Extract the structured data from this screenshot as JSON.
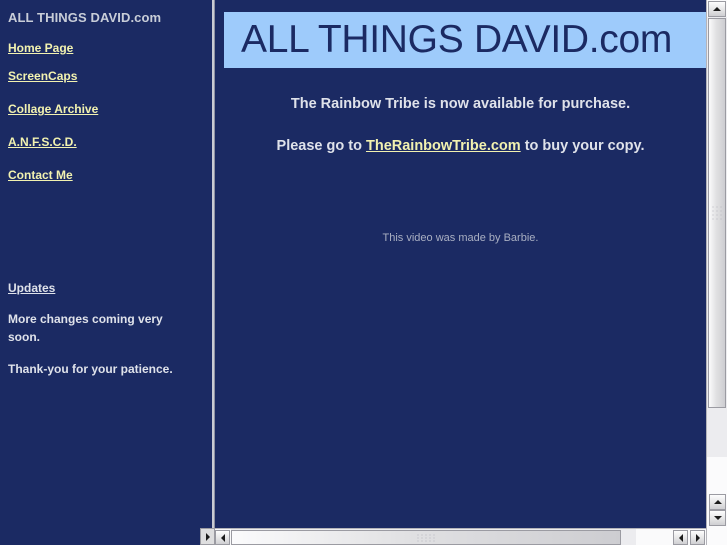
{
  "sidebar": {
    "site_title": "ALL THINGS DAVID.com",
    "nav_links": [
      {
        "label": "Home Page",
        "name": "nav-link-home-page"
      },
      {
        "label": "ScreenCaps",
        "name": "nav-link-screencaps"
      },
      {
        "label": "Collage Archive",
        "name": "nav-link-collage-archive"
      },
      {
        "label": "A.N.F.S.C.D.",
        "name": "nav-link-anfscd"
      },
      {
        "label": "Contact Me",
        "name": "nav-link-contact-me"
      }
    ],
    "updates": {
      "heading": "Updates",
      "paragraphs": [
        "More changes coming very soon.",
        "Thank-you for your patience."
      ]
    }
  },
  "content": {
    "banner_text": "ALL THINGS DAVID.com",
    "promo_line_1": "The Rainbow Tribe is now available for purchase.",
    "promo_prefix": "Please go to ",
    "promo_link": "TheRainbowTribe.com",
    "promo_suffix": " to buy your copy.",
    "video_credit": "This video was made by Barbie."
  },
  "colors": {
    "page_background": "#1b2a63",
    "banner_background": "#9ecbfb",
    "banner_text": "#1b2a63",
    "link": "#f2f2b0",
    "body_text": "#dfe2ea",
    "muted_text": "#a9afc2",
    "scrollbar_track": "#ececef",
    "scrollbar_face": "#e1e1e3"
  },
  "scrollbars": {
    "vertical": {
      "up_arrow": "scroll-up-arrow",
      "down_arrow": "scroll-down-arrow",
      "thumb": "vertical-scroll-thumb"
    },
    "horizontal": {
      "left_arrow": "scroll-left-arrow",
      "right_arrow": "scroll-right-arrow",
      "thumb": "horizontal-scroll-thumb"
    }
  }
}
